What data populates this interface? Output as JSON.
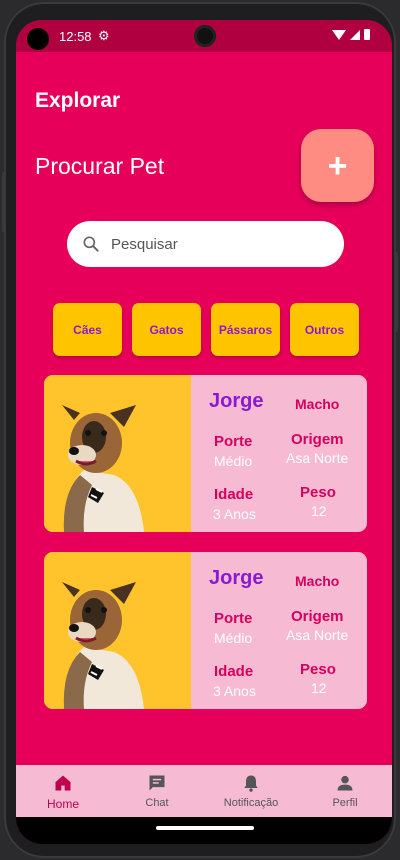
{
  "status_bar": {
    "time": "12:58",
    "gear": "⚙"
  },
  "header": {
    "title": "Explorar",
    "subtitle": "Procurar Pet",
    "add_label": "+"
  },
  "search": {
    "placeholder": "Pesquisar"
  },
  "categories": [
    "Cães",
    "Gatos",
    "Pássaros",
    "Outros"
  ],
  "pets": [
    {
      "name": "Jorge",
      "sex": "Macho",
      "porte_label": "Porte",
      "porte": "Médio",
      "origem_label": "Origem",
      "origem": "Asa Norte",
      "idade_label": "Idade",
      "idade": "3 Anos",
      "peso_label": "Peso",
      "peso": "12"
    },
    {
      "name": "Jorge",
      "sex": "Macho",
      "porte_label": "Porte",
      "porte": "Médio",
      "origem_label": "Origem",
      "origem": "Asa Norte",
      "idade_label": "Idade",
      "idade": "3 Anos",
      "peso_label": "Peso",
      "peso": "12"
    }
  ],
  "nav": [
    {
      "label": "Home",
      "icon": "home-icon"
    },
    {
      "label": "Chat",
      "icon": "chat-icon"
    },
    {
      "label": "Notificação",
      "icon": "bell-icon"
    },
    {
      "label": "Perfil",
      "icon": "person-icon"
    }
  ],
  "colors": {
    "background": "#E60059",
    "status_bar": "#B0003F",
    "fab": "#FF8C82",
    "chip": "#FFC400",
    "chip_text": "#8A1ACF",
    "card": "#F6BBD3",
    "photo_bg": "#FFC42C",
    "name": "#8A1ACF",
    "label": "#D5005E"
  }
}
